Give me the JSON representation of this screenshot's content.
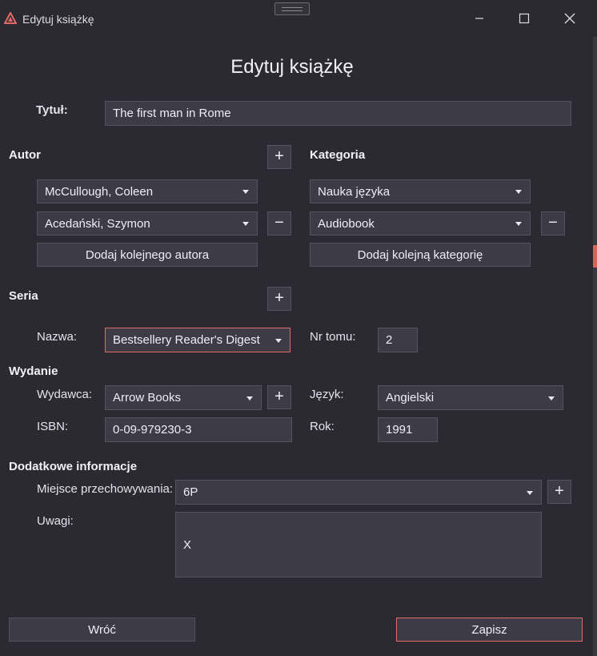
{
  "window": {
    "title": "Edytuj książkę",
    "accent": "#e06a66",
    "controls": {
      "minimize": "minimize-icon",
      "maximize": "maximize-icon",
      "close": "close-icon"
    }
  },
  "heading": "Edytuj książkę",
  "title_field": {
    "label": "Tytuł:",
    "value": "The first man in Rome"
  },
  "authors": {
    "label": "Autor",
    "add": "+",
    "items": [
      "McCullough, Coleen",
      "Acedański, Szymon"
    ],
    "remove": "−",
    "add_button": "Dodaj kolejnego autora"
  },
  "categories": {
    "label": "Kategoria",
    "items": [
      "Nauka języka",
      "Audiobook"
    ],
    "remove": "−",
    "add_button": "Dodaj kolejną kategorię"
  },
  "series": {
    "label": "Seria",
    "add": "+",
    "name_label": "Nazwa:",
    "name_value": "Bestsellery Reader's Digest",
    "volume_label": "Nr tomu:",
    "volume_value": "2"
  },
  "edition": {
    "label": "Wydanie",
    "publisher_label": "Wydawca:",
    "publisher_value": "Arrow Books",
    "publisher_add": "+",
    "language_label": "Język:",
    "language_value": "Angielski",
    "isbn_label": "ISBN:",
    "isbn_value": "0-09-979230-3",
    "year_label": "Rok:",
    "year_value": "1991"
  },
  "extra": {
    "label": "Dodatkowe informacje",
    "storage_label": "Miejsce przechowywania:",
    "storage_value": "6P",
    "storage_add": "+",
    "notes_label": "Uwagi:",
    "notes_value": "X"
  },
  "footer": {
    "back": "Wróć",
    "save": "Zapisz"
  }
}
